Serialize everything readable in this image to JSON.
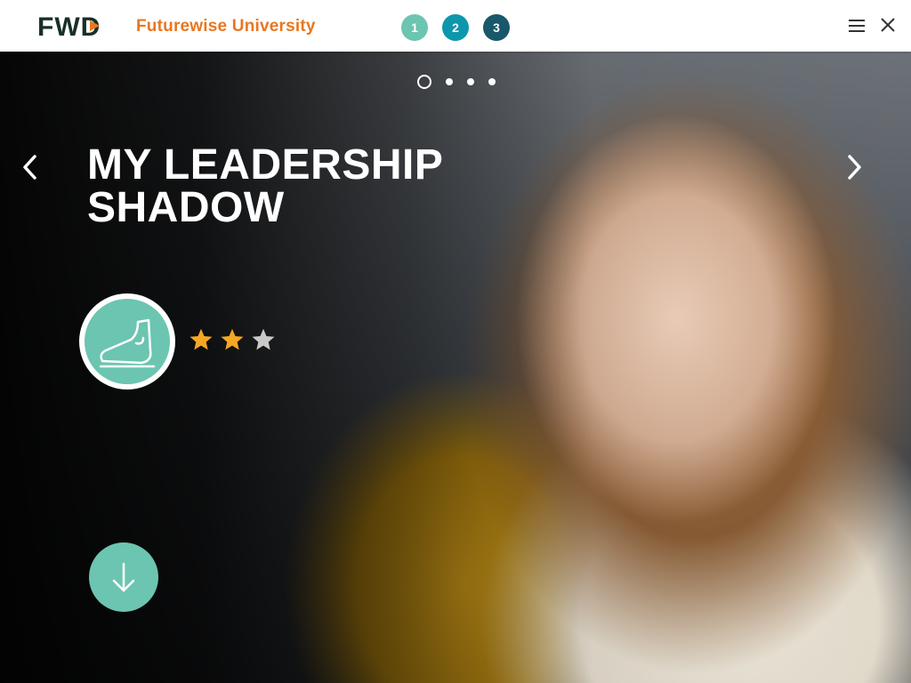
{
  "header": {
    "logo_text": "FWD",
    "brand_title": "Futurewise University",
    "steps": [
      {
        "label": "1",
        "color": "#6cc5b0"
      },
      {
        "label": "2",
        "color": "#0d97ac"
      },
      {
        "label": "3",
        "color": "#18586a"
      }
    ],
    "menu_icon": "hamburger-menu-icon",
    "close_icon": "close-icon"
  },
  "hero": {
    "title": "MY LEADERSHIP SHADOW",
    "pager": {
      "total": 4,
      "active": 1
    },
    "badge_icon": "footprint-icon",
    "rating": {
      "filled": 2,
      "total": 3,
      "filled_color": "#f5a623",
      "empty_color": "#c9c9c9"
    },
    "scroll_icon": "arrow-down-icon",
    "accent_color": "#6cc5b0"
  }
}
